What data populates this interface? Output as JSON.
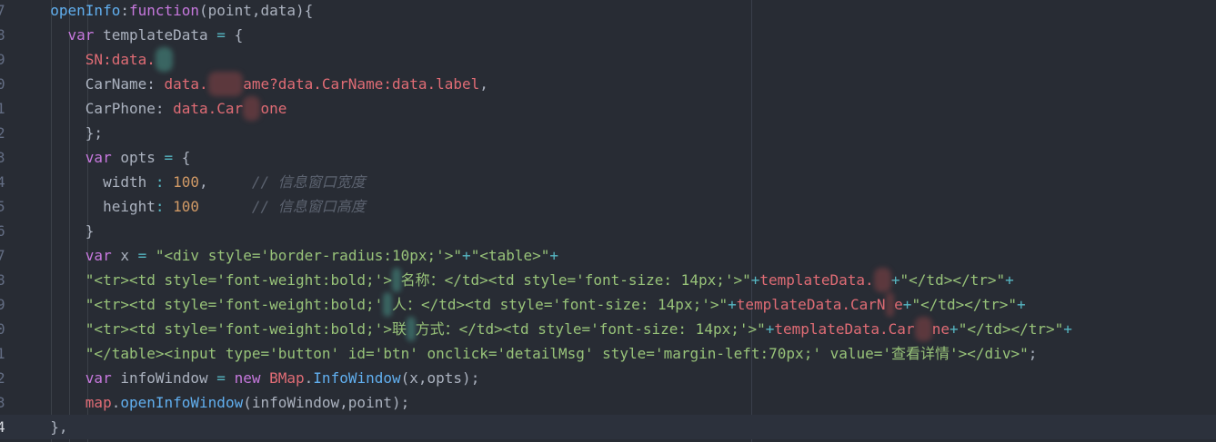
{
  "editor": {
    "active_line_number": "4",
    "lines": [
      {
        "n": "7",
        "tokens": [
          {
            "t": "  ",
            "c": "pl"
          },
          {
            "t": "openInfo",
            "c": "fn"
          },
          {
            "t": ":",
            "c": "pl"
          },
          {
            "t": "function",
            "c": "kw"
          },
          {
            "t": "(point,data){",
            "c": "pl"
          }
        ]
      },
      {
        "n": "8",
        "tokens": [
          {
            "t": "    ",
            "c": "pl"
          },
          {
            "t": "var",
            "c": "kw"
          },
          {
            "t": " templateData ",
            "c": "pl"
          },
          {
            "t": "=",
            "c": "op"
          },
          {
            "t": " {",
            "c": "pl"
          }
        ]
      },
      {
        "n": "9",
        "tokens": [
          {
            "t": "      ",
            "c": "pl"
          },
          {
            "t": "SN:",
            "c": "prop"
          },
          {
            "t": "data.",
            "c": "prop"
          },
          {
            "t": "  ",
            "c": "blur"
          }
        ]
      },
      {
        "n": "0",
        "tokens": [
          {
            "t": "      ",
            "c": "pl"
          },
          {
            "t": "CarName: ",
            "c": "pl"
          },
          {
            "t": "data.",
            "c": "prop"
          },
          {
            "t": "    ",
            "c": "blurred"
          },
          {
            "t": "ame?data.CarName:data.label",
            "c": "prop"
          },
          {
            "t": ",",
            "c": "pl"
          }
        ]
      },
      {
        "n": "1",
        "tokens": [
          {
            "t": "      ",
            "c": "pl"
          },
          {
            "t": "CarPhone: ",
            "c": "pl"
          },
          {
            "t": "data.Car",
            "c": "prop"
          },
          {
            "t": "  ",
            "c": "blurred"
          },
          {
            "t": "one",
            "c": "prop"
          }
        ]
      },
      {
        "n": "2",
        "tokens": [
          {
            "t": "      ",
            "c": "pl"
          },
          {
            "t": "};",
            "c": "pl"
          }
        ]
      },
      {
        "n": "3",
        "tokens": [
          {
            "t": "      ",
            "c": "pl"
          },
          {
            "t": "var",
            "c": "kw"
          },
          {
            "t": " opts ",
            "c": "pl"
          },
          {
            "t": "=",
            "c": "op"
          },
          {
            "t": " {",
            "c": "pl"
          }
        ]
      },
      {
        "n": "4",
        "tokens": [
          {
            "t": "        ",
            "c": "pl"
          },
          {
            "t": "width ",
            "c": "pl"
          },
          {
            "t": ":",
            "c": "op"
          },
          {
            "t": " ",
            "c": "pl"
          },
          {
            "t": "100",
            "c": "num"
          },
          {
            "t": ",     ",
            "c": "pl"
          },
          {
            "t": "// 信息窗口宽度",
            "c": "cmt"
          }
        ]
      },
      {
        "n": "5",
        "tokens": [
          {
            "t": "        ",
            "c": "pl"
          },
          {
            "t": "height",
            "c": "pl"
          },
          {
            "t": ":",
            "c": "op"
          },
          {
            "t": " ",
            "c": "pl"
          },
          {
            "t": "100",
            "c": "num"
          },
          {
            "t": "      ",
            "c": "pl"
          },
          {
            "t": "// 信息窗口高度",
            "c": "cmt"
          }
        ]
      },
      {
        "n": "6",
        "tokens": [
          {
            "t": "      ",
            "c": "pl"
          },
          {
            "t": "}",
            "c": "pl"
          }
        ]
      },
      {
        "n": "7",
        "tokens": [
          {
            "t": "      ",
            "c": "pl"
          },
          {
            "t": "var",
            "c": "kw"
          },
          {
            "t": " x ",
            "c": "pl"
          },
          {
            "t": "=",
            "c": "op"
          },
          {
            "t": " ",
            "c": "pl"
          },
          {
            "t": "\"<div style='border-radius:10px;'>\"",
            "c": "str"
          },
          {
            "t": "+",
            "c": "op"
          },
          {
            "t": "\"<table>\"",
            "c": "str"
          },
          {
            "t": "+",
            "c": "op"
          }
        ]
      },
      {
        "n": "8",
        "tokens": [
          {
            "t": "      ",
            "c": "pl"
          },
          {
            "t": "\"<tr><td style='font-weight:bold;'>",
            "c": "str"
          },
          {
            "t": " ",
            "c": "blur"
          },
          {
            "t": "名称：</td><td style='font-size: 14px;'>\"",
            "c": "str"
          },
          {
            "t": "+",
            "c": "op"
          },
          {
            "t": "templateData.",
            "c": "prop"
          },
          {
            "t": "  ",
            "c": "blurred"
          },
          {
            "t": "+",
            "c": "op"
          },
          {
            "t": "\"</td></tr>\"",
            "c": "str"
          },
          {
            "t": "+",
            "c": "op"
          }
        ]
      },
      {
        "n": "9",
        "tokens": [
          {
            "t": "      ",
            "c": "pl"
          },
          {
            "t": "\"<tr><td style='font-weight:bold;'",
            "c": "str"
          },
          {
            "t": " ",
            "c": "blur"
          },
          {
            "t": "人：</td><td style='font-size: 14px;'>\"",
            "c": "str"
          },
          {
            "t": "+",
            "c": "op"
          },
          {
            "t": "templateData.CarN",
            "c": "prop"
          },
          {
            "t": " ",
            "c": "blurred"
          },
          {
            "t": "e",
            "c": "prop"
          },
          {
            "t": "+",
            "c": "op"
          },
          {
            "t": "\"</td></tr>\"",
            "c": "str"
          },
          {
            "t": "+",
            "c": "op"
          }
        ]
      },
      {
        "n": "0",
        "tokens": [
          {
            "t": "      ",
            "c": "pl"
          },
          {
            "t": "\"<tr><td style='font-weight:bold;'>联",
            "c": "str"
          },
          {
            "t": " ",
            "c": "blur"
          },
          {
            "t": "方式：</td><td style='font-size: 14px;'>\"",
            "c": "str"
          },
          {
            "t": "+",
            "c": "op"
          },
          {
            "t": "templateData.Car",
            "c": "prop"
          },
          {
            "t": "  ",
            "c": "blurred"
          },
          {
            "t": "ne",
            "c": "prop"
          },
          {
            "t": "+",
            "c": "op"
          },
          {
            "t": "\"</td></tr>\"",
            "c": "str"
          },
          {
            "t": "+",
            "c": "op"
          }
        ]
      },
      {
        "n": "1",
        "tokens": [
          {
            "t": "      ",
            "c": "pl"
          },
          {
            "t": "\"</table><input type='button' id='btn' onclick='detailMsg' style='margin-left:70px;' value='查看详情'></div>\"",
            "c": "str"
          },
          {
            "t": ";",
            "c": "pl"
          }
        ]
      },
      {
        "n": "2",
        "tokens": [
          {
            "t": "      ",
            "c": "pl"
          },
          {
            "t": "var",
            "c": "kw"
          },
          {
            "t": " infoWindow ",
            "c": "pl"
          },
          {
            "t": "=",
            "c": "op"
          },
          {
            "t": " ",
            "c": "pl"
          },
          {
            "t": "new",
            "c": "kw"
          },
          {
            "t": " ",
            "c": "pl"
          },
          {
            "t": "BMap",
            "c": "prop"
          },
          {
            "t": ".",
            "c": "pl"
          },
          {
            "t": "InfoWindow",
            "c": "fn"
          },
          {
            "t": "(x,opts);",
            "c": "pl"
          }
        ]
      },
      {
        "n": "3",
        "tokens": [
          {
            "t": "      ",
            "c": "pl"
          },
          {
            "t": "map",
            "c": "prop"
          },
          {
            "t": ".",
            "c": "pl"
          },
          {
            "t": "openInfoWindow",
            "c": "fn"
          },
          {
            "t": "(infoWindow,point);",
            "c": "pl"
          }
        ]
      },
      {
        "n": "4",
        "active": true,
        "tokens": [
          {
            "t": "  ",
            "c": "pl"
          },
          {
            "t": "},",
            "c": "pl"
          }
        ]
      }
    ]
  }
}
